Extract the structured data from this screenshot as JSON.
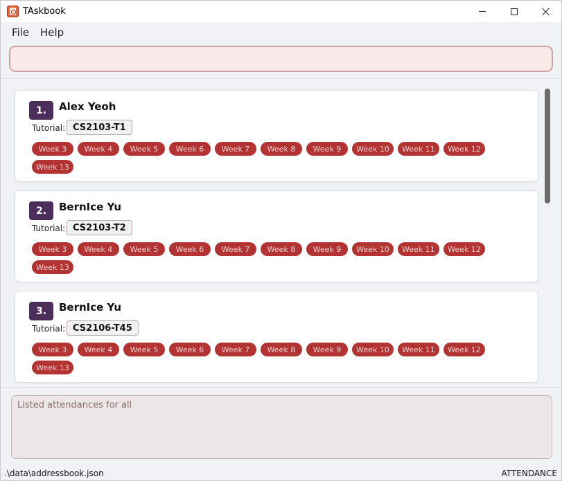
{
  "window": {
    "title": "TAskbook"
  },
  "menu": {
    "file": "File",
    "help": "Help"
  },
  "command": {
    "value": "",
    "placeholder": ""
  },
  "persons": [
    {
      "index": "1.",
      "name": "Alex Yeoh",
      "tutorial_label": "Tutorial:",
      "tutorial": "CS2103-T1",
      "weeks": [
        "Week 3",
        "Week 4",
        "Week 5",
        "Week 6",
        "Week 7",
        "Week 8",
        "Week 9",
        "Week 10",
        "Week 11",
        "Week 12",
        "Week 13"
      ]
    },
    {
      "index": "2.",
      "name": "BernIce Yu",
      "tutorial_label": "Tutorial:",
      "tutorial": "CS2103-T2",
      "weeks": [
        "Week 3",
        "Week 4",
        "Week 5",
        "Week 6",
        "Week 7",
        "Week 8",
        "Week 9",
        "Week 10",
        "Week 11",
        "Week 12",
        "Week 13"
      ]
    },
    {
      "index": "3.",
      "name": "BernIce Yu",
      "tutorial_label": "Tutorial:",
      "tutorial": "CS2106-T45",
      "weeks": [
        "Week 3",
        "Week 4",
        "Week 5",
        "Week 6",
        "Week 7",
        "Week 8",
        "Week 9",
        "Week 10",
        "Week 11",
        "Week 12",
        "Week 13"
      ]
    }
  ],
  "result": {
    "message": "Listed attendances for all"
  },
  "status": {
    "file_path": ".\\data\\addressbook.json",
    "mode": "ATTENDANCE"
  },
  "colors": {
    "index_badge": "#4b2e5a",
    "week_tag": "#b23331",
    "command_bg": "#fbeaea",
    "result_bg": "#ece6e6"
  },
  "icons": {
    "app": "address-book-icon",
    "minimize": "minimize-icon",
    "maximize": "maximize-icon",
    "close": "close-icon"
  }
}
